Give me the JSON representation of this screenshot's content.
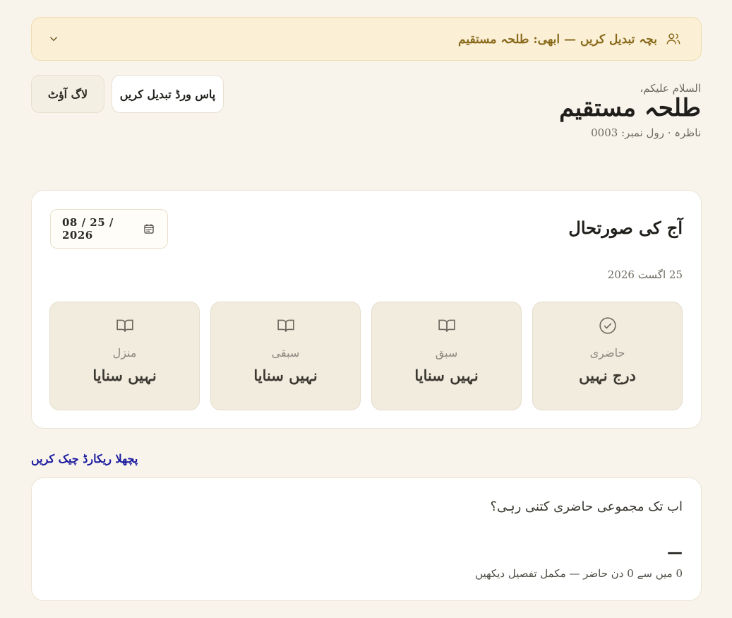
{
  "switcher": {
    "label": "بچہ تبدیل کریں — ابھی: طلحہ مستقیم",
    "icon": "users-icon",
    "chevron": "chevron-down-icon"
  },
  "header": {
    "salam": "السلام علیکم،",
    "student_name": "طلحہ مستقیم",
    "meta": "ناظرہ · رول نمبر: 0003"
  },
  "buttons": {
    "change_password": "پاس ورڈ تبدیل کریں",
    "logout": "لاگ آؤٹ"
  },
  "today": {
    "title": "آج کی صورتحال",
    "date_label": "25 اگست 2026",
    "date_value": "08 / 25 / 2026",
    "stats": [
      {
        "label": "حاضری",
        "value": "درج نہیں",
        "icon": "check-circle-icon"
      },
      {
        "label": "سبق",
        "value": "نہیں سنایا",
        "icon": "book-open-icon"
      },
      {
        "label": "سبقی",
        "value": "نہیں سنایا",
        "icon": "book-open-icon"
      },
      {
        "label": "منزل",
        "value": "نہیں سنایا",
        "icon": "book-open-icon"
      }
    ]
  },
  "records_link": "پچھلا ریکارڈ چیک کریں",
  "attendance": {
    "question": "اب تک مجموعی حاضری کتنی رہی؟",
    "value": "—",
    "summary": "0 میں سے 0 دن حاضر — مکمل تفصیل دیکھیں"
  },
  "colors": {
    "background": "#f8f4ec",
    "switcher_bg": "#fbf0d6",
    "switcher_text": "#8a6a1c",
    "link": "#1a1a9e",
    "stat_bg": "#f2ecdf"
  }
}
